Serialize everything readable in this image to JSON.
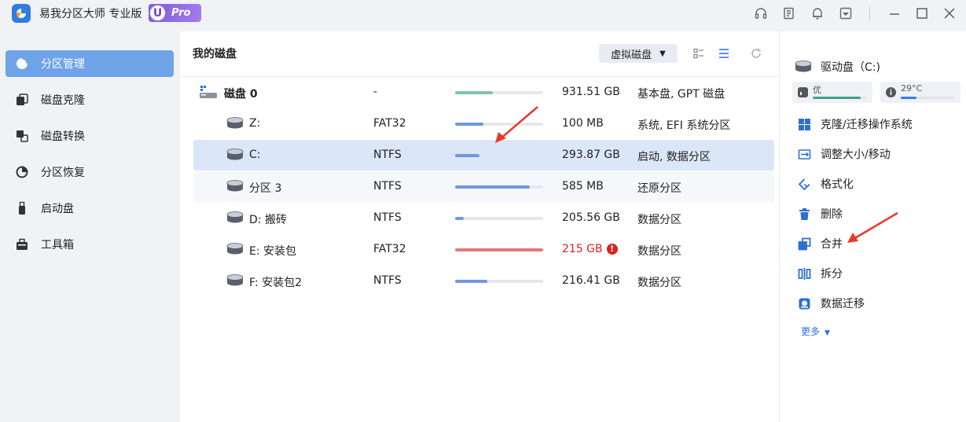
{
  "app": {
    "title": "易我分区大师 专业版",
    "badge_u": "U",
    "badge_pro": "Pro"
  },
  "sidebar": {
    "items": [
      {
        "label": "分区管理",
        "icon": "pie-chart-icon",
        "active": true
      },
      {
        "label": "磁盘克隆",
        "icon": "clone-icon"
      },
      {
        "label": "磁盘转换",
        "icon": "convert-icon"
      },
      {
        "label": "分区恢复",
        "icon": "recovery-icon"
      },
      {
        "label": "启动盘",
        "icon": "usb-icon"
      },
      {
        "label": "工具箱",
        "icon": "toolbox-icon"
      }
    ]
  },
  "main": {
    "title": "我的磁盘",
    "virtual_disk_label": "虚拟磁盘",
    "disk": {
      "name": "磁盘 0",
      "fs": "-",
      "size": "931.51 GB",
      "type": "基本盘, GPT 磁盘",
      "usage": 0.43,
      "bar_color": "#7ec4ae"
    },
    "partitions": [
      {
        "name": "Z:",
        "fs": "FAT32",
        "size": "100 MB",
        "type": "系统, EFI 系统分区",
        "usage": 0.32,
        "bar_color": "#6f99de"
      },
      {
        "name": "C:",
        "fs": "NTFS",
        "size": "293.87 GB",
        "type": "启动, 数据分区",
        "usage": 0.28,
        "bar_color": "#6f99de",
        "selected": true
      },
      {
        "name": "分区 3",
        "fs": "NTFS",
        "size": "585 MB",
        "type": "还原分区",
        "usage": 0.85,
        "bar_color": "#6f99de"
      },
      {
        "name": "D: 搬砖",
        "fs": "NTFS",
        "size": "205.56 GB",
        "type": "数据分区",
        "usage": 0.1,
        "bar_color": "#6f99de"
      },
      {
        "name": "E: 安装包",
        "fs": "FAT32",
        "size": "215 GB",
        "type": "数据分区",
        "usage": 1.0,
        "bar_color": "#e97777",
        "warning": true
      },
      {
        "name": "F: 安装包2",
        "fs": "NTFS",
        "size": "216.41 GB",
        "type": "数据分区",
        "usage": 0.37,
        "bar_color": "#6f99de"
      }
    ],
    "warning_glyph": "!"
  },
  "right": {
    "drive_name": "驱动盘（C:)",
    "health_label": "优",
    "health_level": 0.9,
    "temp_label": "29°C",
    "temp_level": 0.29,
    "actions": [
      {
        "label": "克隆/迁移操作系统",
        "icon": "windows-icon"
      },
      {
        "label": "调整大小/移动",
        "icon": "resize-icon"
      },
      {
        "label": "格式化",
        "icon": "format-icon"
      },
      {
        "label": "删除",
        "icon": "trash-icon"
      },
      {
        "label": "合并",
        "icon": "merge-icon"
      },
      {
        "label": "拆分",
        "icon": "split-icon"
      },
      {
        "label": "数据迁移",
        "icon": "migrate-icon"
      }
    ],
    "more_label": "更多"
  },
  "colors": {
    "accent": "#6fa3e8",
    "action_blue": "#2d6fd2",
    "warn_red": "#e02020",
    "arrow_red": "#e83a2a"
  }
}
